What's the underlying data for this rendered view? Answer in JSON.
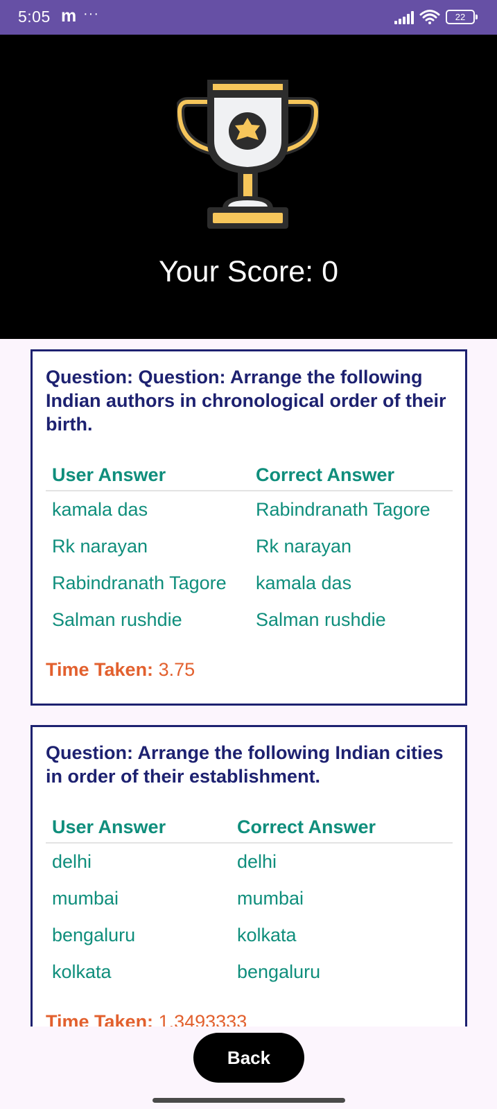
{
  "status_bar": {
    "time": "5:05",
    "app_letter": "m",
    "dots": "···",
    "battery": "22",
    "color": "#6650a5"
  },
  "hero": {
    "icon": "trophy-icon",
    "score_text": "Your Score: 0"
  },
  "results": [
    {
      "question": "Question: Question: Arrange the following Indian authors in chronological order of their birth.",
      "user_answer_label": "User Answer",
      "correct_answer_label": "Correct Answer",
      "rows": [
        {
          "user": "kamala das",
          "correct": "Rabindranath Tagore"
        },
        {
          "user": "Rk narayan",
          "correct": "Rk narayan"
        },
        {
          "user": "Rabindranath Tagore",
          "correct": "kamala das"
        },
        {
          "user": "Salman rushdie",
          "correct": "Salman rushdie"
        }
      ],
      "time_label": "Time Taken:",
      "time_value": "3.75"
    },
    {
      "question": "Question: Arrange the following Indian cities in order of their establishment.",
      "user_answer_label": "User Answer",
      "correct_answer_label": "Correct Answer",
      "rows": [
        {
          "user": "delhi",
          "correct": "delhi"
        },
        {
          "user": "mumbai",
          "correct": "mumbai"
        },
        {
          "user": "bengaluru",
          "correct": "kolkata"
        },
        {
          "user": "kolkata",
          "correct": "bengaluru"
        }
      ],
      "time_label": "Time Taken:",
      "time_value": "1.3493333"
    }
  ],
  "back_label": "Back",
  "colors": {
    "question": "#1d2170",
    "answer": "#0f8e7c",
    "time": "#e2602e",
    "card_border": "#1d2170"
  }
}
